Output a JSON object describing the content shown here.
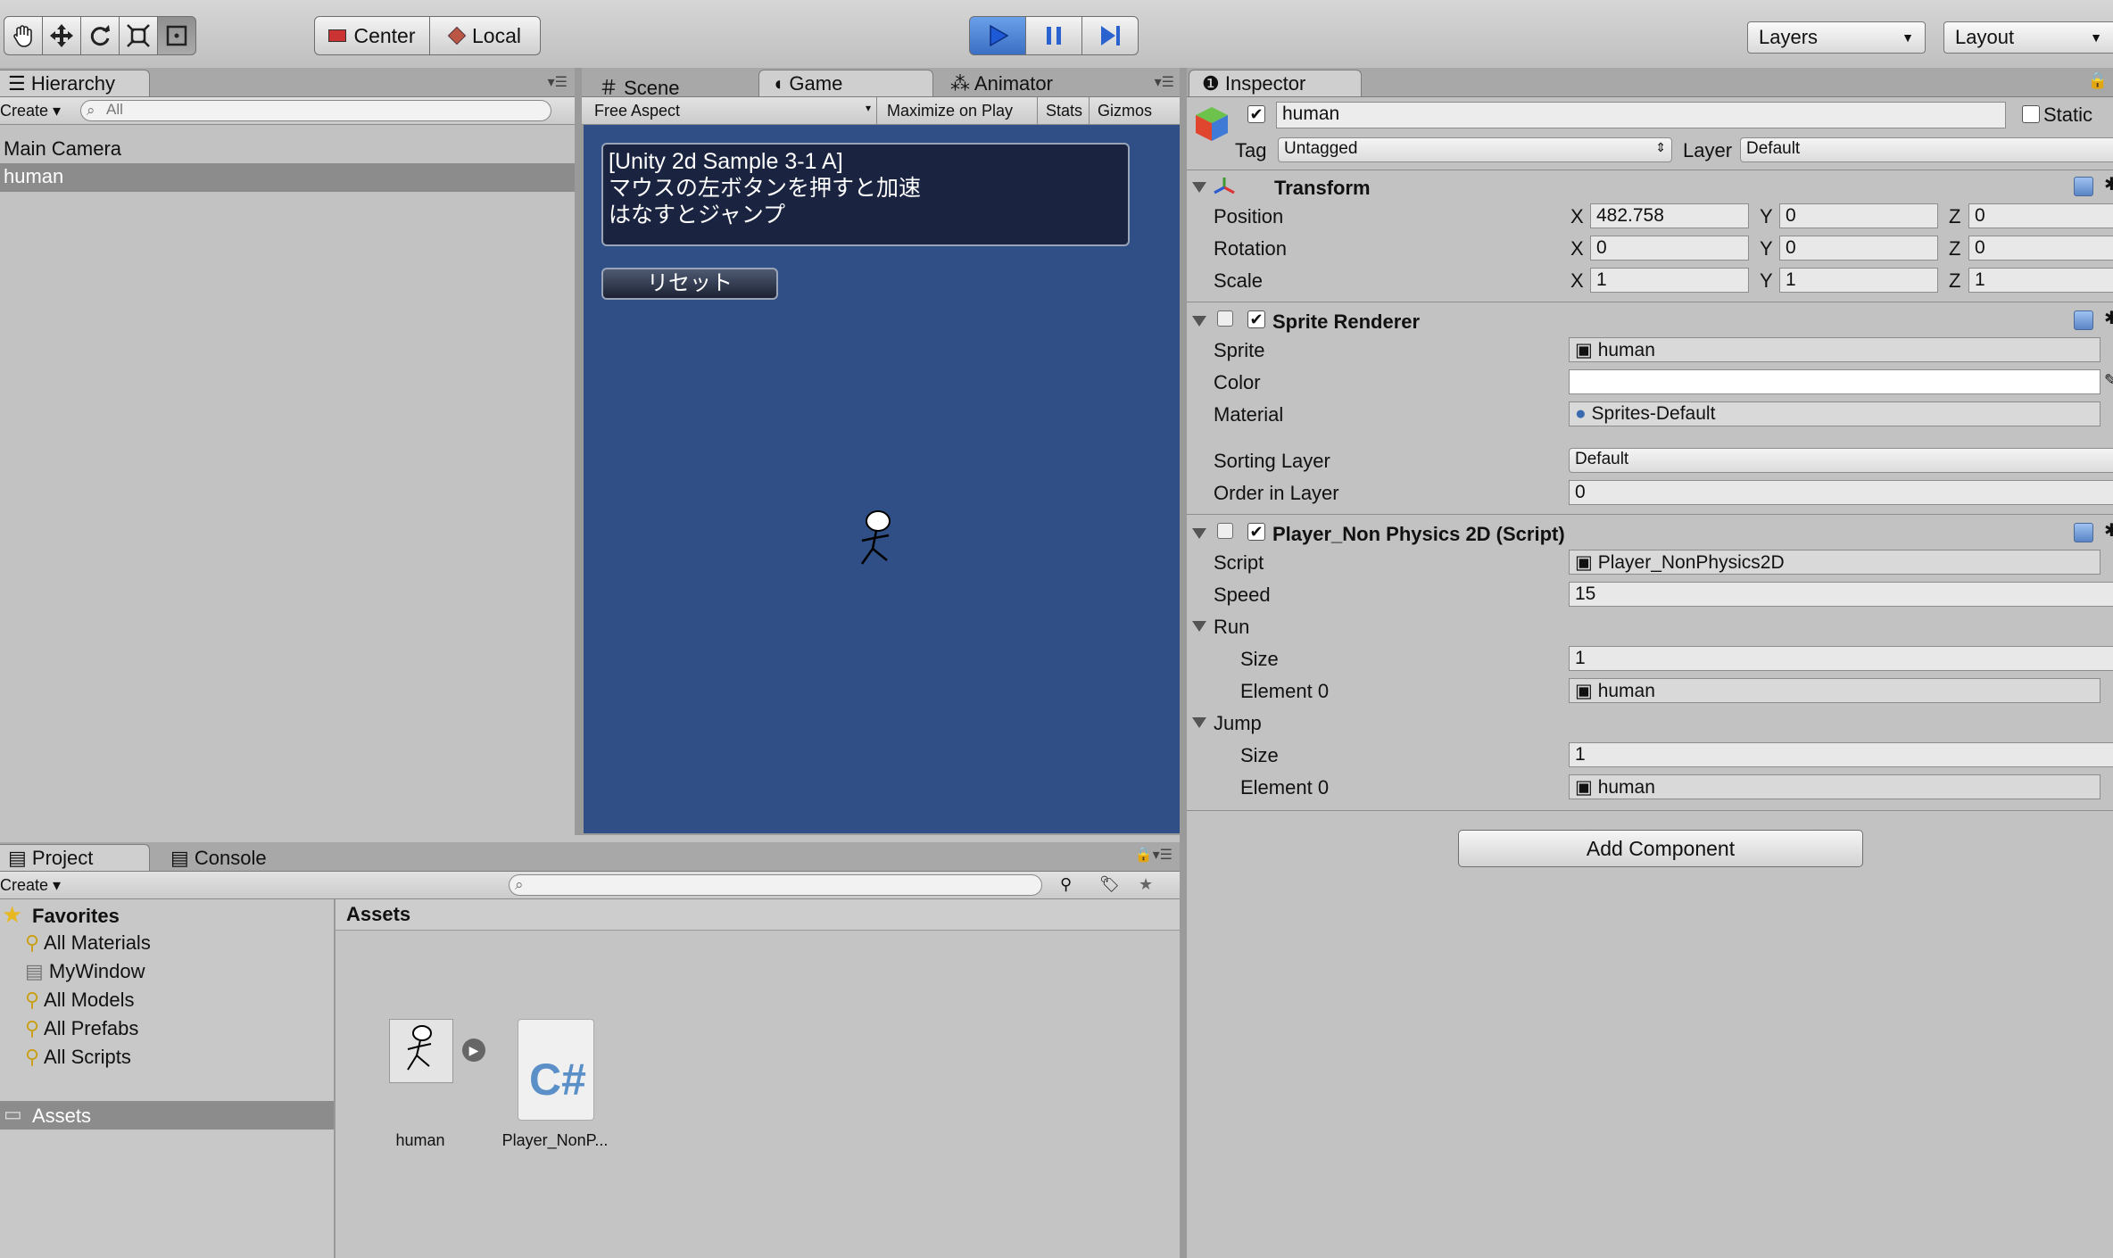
{
  "toolbar": {
    "tools": [
      "hand-icon",
      "move-icon",
      "rotate-icon",
      "scale-icon",
      "rect-icon"
    ],
    "pivot_label": "Center",
    "space_label": "Local",
    "layers_label": "Layers",
    "layout_label": "Layout"
  },
  "hierarchy": {
    "tab_label": "Hierarchy",
    "create_label": "Create",
    "search_placeholder": "All",
    "items": [
      "Main Camera",
      "human"
    ]
  },
  "game_view": {
    "tabs": [
      "Scene",
      "Game",
      "Animator"
    ],
    "aspect_label": "Free Aspect",
    "maximize_label": "Maximize on Play",
    "stats_label": "Stats",
    "gizmos_label": "Gizmos",
    "info_line1": "[Unity 2d Sample 3-1 A]",
    "info_line2": "マウスの左ボタンを押すと加速",
    "info_line3": "はなすとジャンプ",
    "reset_label": "リセット",
    "background_color": "#2f4f86"
  },
  "inspector": {
    "tab_label": "Inspector",
    "object_name": "human",
    "static_label": "Static",
    "tag_label": "Tag",
    "tag_value": "Untagged",
    "layer_label": "Layer",
    "layer_value": "Default",
    "transform": {
      "title": "Transform",
      "position_label": "Position",
      "rotation_label": "Rotation",
      "scale_label": "Scale",
      "position": {
        "x": "482.758",
        "y": "0",
        "z": "0"
      },
      "rotation": {
        "x": "0",
        "y": "0",
        "z": "0"
      },
      "scale": {
        "x": "1",
        "y": "1",
        "z": "1"
      }
    },
    "sprite_renderer": {
      "title": "Sprite Renderer",
      "sprite_label": "Sprite",
      "sprite_value": "human",
      "color_label": "Color",
      "material_label": "Material",
      "material_value": "Sprites-Default",
      "sorting_layer_label": "Sorting Layer",
      "sorting_layer_value": "Default",
      "order_label": "Order in Layer",
      "order_value": "0"
    },
    "script_component": {
      "title": "Player_Non Physics 2D (Script)",
      "script_label": "Script",
      "script_value": "Player_NonPhysics2D",
      "speed_label": "Speed",
      "speed_value": "15",
      "run_label": "Run",
      "run_size_label": "Size",
      "run_size_value": "1",
      "run_element_label": "Element 0",
      "run_element_value": "human",
      "jump_label": "Jump",
      "jump_size_label": "Size",
      "jump_size_value": "1",
      "jump_element_label": "Element 0",
      "jump_element_value": "human"
    },
    "add_component_label": "Add Component"
  },
  "project": {
    "tabs": [
      "Project",
      "Console"
    ],
    "create_label": "Create",
    "favorites_label": "Favorites",
    "favorites": [
      "All Materials",
      "MyWindow",
      "All Models",
      "All Prefabs",
      "All Scripts"
    ],
    "assets_folder_label": "Assets",
    "assets_header": "Assets",
    "assets": [
      "human",
      "Player_NonP..."
    ]
  }
}
